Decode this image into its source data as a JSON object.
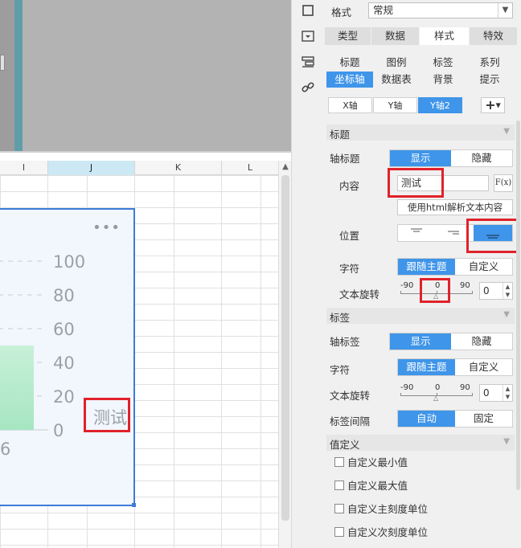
{
  "sheet": {
    "columns": [
      "I",
      "J",
      "K",
      "L"
    ],
    "selected_column": "J"
  },
  "chart": {
    "more_label": "•••",
    "axis_title": "测试",
    "tick_partial": "6",
    "accent_color": "#3d7bd8"
  },
  "chart_data": {
    "type": "bar",
    "y_ticks": [
      "100",
      "80",
      "60",
      "40",
      "20",
      "0"
    ],
    "ylim": [
      0,
      100
    ],
    "values": [
      50
    ],
    "ylabel": "测试"
  },
  "panel": {
    "format_label": "格式",
    "format_value": "常规",
    "main_tabs": [
      {
        "label": "类型",
        "active": false
      },
      {
        "label": "数据",
        "active": false
      },
      {
        "label": "样式",
        "active": true
      },
      {
        "label": "特效",
        "active": false
      }
    ],
    "style_tabs_row1": [
      "标题",
      "图例",
      "标签",
      "系列"
    ],
    "style_tabs_row2": [
      "坐标轴",
      "数据表",
      "背景",
      "提示"
    ],
    "active_style_tab": "坐标轴",
    "axis_tabs": [
      "X轴",
      "Y轴",
      "Y轴2"
    ],
    "active_axis_tab": "Y轴2",
    "add_button": "+",
    "title_section": {
      "header": "标题",
      "axis_title_label": "轴标题",
      "show": "显示",
      "hide": "隐藏",
      "content_label": "内容",
      "content_value": "测试",
      "fx_label": "F(x)",
      "html_button": "使用html解析文本内容",
      "position_label": "位置",
      "font_label": "字符",
      "follow_theme": "跟随主题",
      "custom": "自定义",
      "rotation_label": "文本旋转",
      "rotation_min": "-90",
      "rotation_mid": "0",
      "rotation_max": "90",
      "rotation_value": "0"
    },
    "label_section": {
      "header": "标签",
      "axis_label_label": "轴标签",
      "show": "显示",
      "hide": "隐藏",
      "font_label": "字符",
      "follow_theme": "跟随主题",
      "custom": "自定义",
      "rotation_label": "文本旋转",
      "rotation_min": "-90",
      "rotation_mid": "0",
      "rotation_max": "90",
      "rotation_value": "0",
      "interval_label": "标签间隔",
      "auto": "自动",
      "fixed": "固定"
    },
    "value_section": {
      "header": "值定义",
      "options": [
        "自定义最小值",
        "自定义最大值",
        "自定义主刻度单位",
        "自定义次刻度单位"
      ]
    }
  }
}
